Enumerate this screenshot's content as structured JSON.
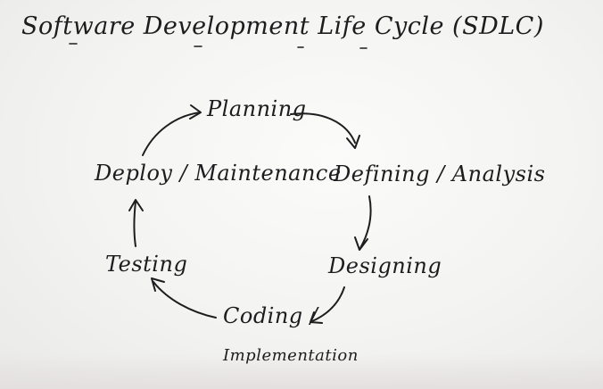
{
  "title": "Software Development Life Cycle (SDLC)",
  "stages": {
    "planning": "Planning",
    "defining": "Defining / Analysis",
    "designing": "Designing",
    "coding": "Coding /",
    "implementation": "Implementation",
    "testing": "Testing",
    "deploy": "Deploy / Maintenance"
  },
  "colors": {
    "ink": "#1d1d1f",
    "board": "#f4f4f2"
  }
}
